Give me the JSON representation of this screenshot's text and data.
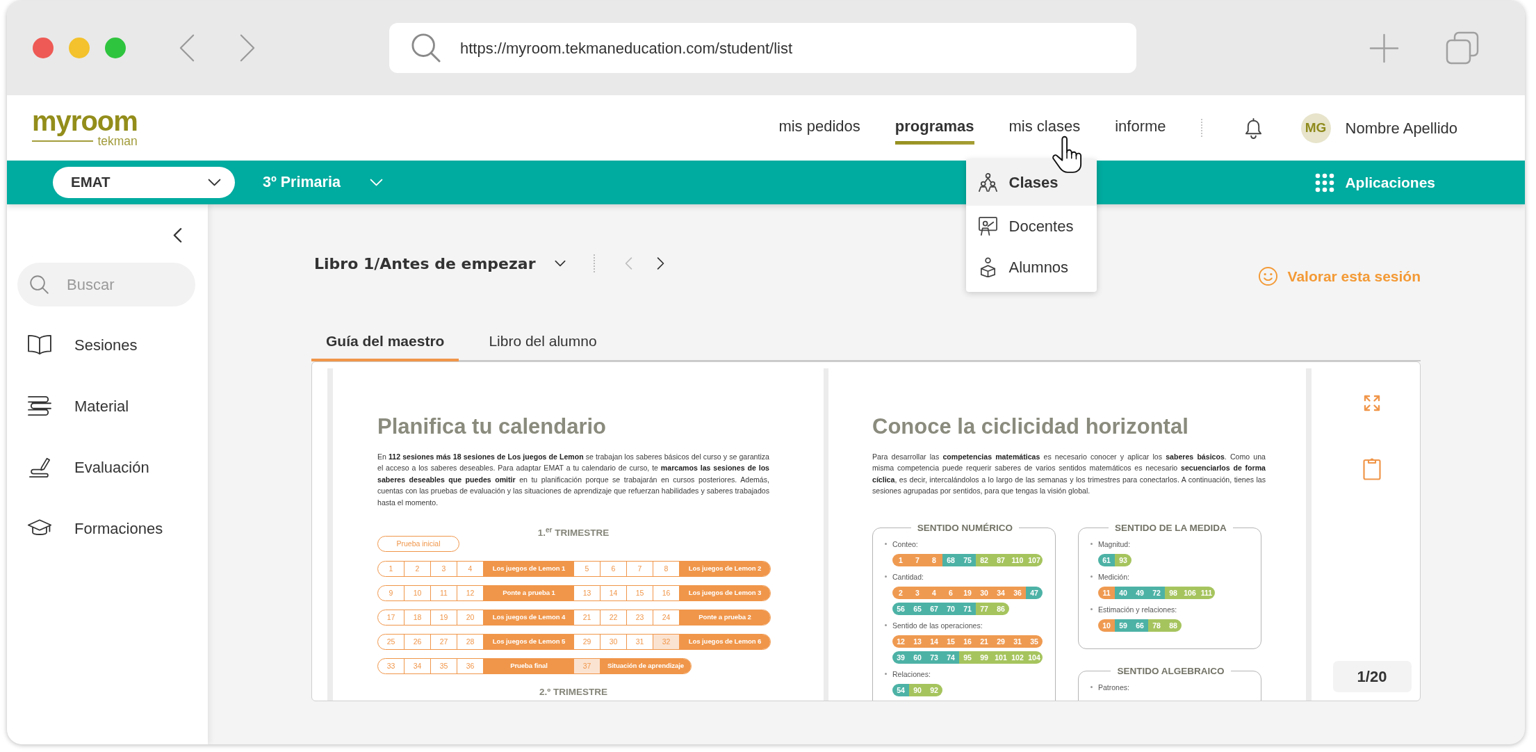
{
  "browser": {
    "url": "https://myroom.tekmaneducation.com/student/list"
  },
  "header": {
    "logo": {
      "name": "myroom",
      "tagline": "tekman"
    },
    "nav": [
      {
        "label": "mis pedidos",
        "selected": false
      },
      {
        "label": "programas",
        "selected": true
      },
      {
        "label": "mis clases",
        "selected": false,
        "menu": [
          {
            "label": "Clases",
            "selected": true
          },
          {
            "label": "Docentes",
            "selected": false
          },
          {
            "label": "Alumnos",
            "selected": false
          }
        ]
      },
      {
        "label": "informe",
        "selected": false
      }
    ],
    "user": {
      "initials": "MG",
      "name": "Nombre Apellido"
    }
  },
  "subheader": {
    "program": "EMAT",
    "grade": "3º Primaria",
    "apps": "Aplicaciones"
  },
  "sidebar": {
    "search": {
      "placeholder": "Buscar"
    },
    "items": [
      {
        "label": "Sesiones"
      },
      {
        "label": "Material"
      },
      {
        "label": "Evaluación"
      },
      {
        "label": "Formaciones"
      }
    ]
  },
  "toolbar": {
    "title": "Libro 1/Antes de empezar",
    "previous": {
      "disabled": true
    },
    "next": {
      "disabled": false
    },
    "rate": "Valorar esta sesión"
  },
  "tabs": [
    {
      "label": "Guía del maestro",
      "selected": true
    },
    {
      "label": "Libro del alumno",
      "selected": false
    }
  ],
  "viewer": {
    "pages": [
      {
        "kind": "calendar",
        "title": "Planifica tu calendario",
        "intro": "En **112 sesiones más 18 sesiones de Los juegos de Lemon** se trabajan los saberes básicos del curso y se garantiza el acceso a los saberes deseables. Para adaptar EMAT a tu calendario de curso, te **marcamos las sesiones de los saberes deseables que puedes omitir** en tu planificación porque se trabajarán en cursos posteriores. Además, cuentas con las pruebas de evaluación y las situaciones de aprendizaje que refuerzan habilidades y saberes trabajados hasta el momento.",
        "terms": [
          {
            "heading": "1.$^{er}$ TRIMESTRE",
            "badge": "Prueba inicial",
            "rows": [
              {
                "cells": [
                  {
                    "kind": "session",
                    "text": "1",
                    "highlighted": false
                  },
                  {
                    "kind": "session",
                    "text": "2",
                    "highlighted": false
                  },
                  {
                    "kind": "session",
                    "text": "3",
                    "highlighted": false
                  },
                  {
                    "kind": "session",
                    "text": "4",
                    "highlighted": false
                  },
                  {
                    "kind": "activity",
                    "text": "Los juegos de Lemon 1"
                  },
                  {
                    "kind": "session",
                    "text": "5",
                    "highlighted": false
                  },
                  {
                    "kind": "session",
                    "text": "6",
                    "highlighted": false
                  },
                  {
                    "kind": "session",
                    "text": "7",
                    "highlighted": false
                  },
                  {
                    "kind": "session",
                    "text": "8",
                    "highlighted": false
                  },
                  {
                    "kind": "activity",
                    "text": "Los juegos de Lemon 2"
                  }
                ]
              },
              {
                "cells": [
                  {
                    "kind": "session",
                    "text": "9",
                    "highlighted": false
                  },
                  {
                    "kind": "session",
                    "text": "10",
                    "highlighted": false
                  },
                  {
                    "kind": "session",
                    "text": "11",
                    "highlighted": false
                  },
                  {
                    "kind": "session",
                    "text": "12",
                    "highlighted": false
                  },
                  {
                    "kind": "activity",
                    "text": "Ponte a prueba 1"
                  },
                  {
                    "kind": "session",
                    "text": "13",
                    "highlighted": false
                  },
                  {
                    "kind": "session",
                    "text": "14",
                    "highlighted": false
                  },
                  {
                    "kind": "session",
                    "text": "15",
                    "highlighted": false
                  },
                  {
                    "kind": "session",
                    "text": "16",
                    "highlighted": false
                  },
                  {
                    "kind": "activity",
                    "text": "Los juegos de Lemon 3"
                  }
                ]
              },
              {
                "cells": [
                  {
                    "kind": "session",
                    "text": "17",
                    "highlighted": false
                  },
                  {
                    "kind": "session",
                    "text": "18",
                    "highlighted": false
                  },
                  {
                    "kind": "session",
                    "text": "19",
                    "highlighted": false
                  },
                  {
                    "kind": "session",
                    "text": "20",
                    "highlighted": false
                  },
                  {
                    "kind": "activity",
                    "text": "Los juegos de Lemon 4"
                  },
                  {
                    "kind": "session",
                    "text": "21",
                    "highlighted": false
                  },
                  {
                    "kind": "session",
                    "text": "22",
                    "highlighted": false
                  },
                  {
                    "kind": "session",
                    "text": "23",
                    "highlighted": false
                  },
                  {
                    "kind": "session",
                    "text": "24",
                    "highlighted": false
                  },
                  {
                    "kind": "activity",
                    "text": "Ponte a prueba 2"
                  }
                ]
              },
              {
                "cells": [
                  {
                    "kind": "session",
                    "text": "25",
                    "highlighted": false
                  },
                  {
                    "kind": "session",
                    "text": "26",
                    "highlighted": false
                  },
                  {
                    "kind": "session",
                    "text": "27",
                    "highlighted": false
                  },
                  {
                    "kind": "session",
                    "text": "28",
                    "highlighted": false
                  },
                  {
                    "kind": "activity",
                    "text": "Los juegos de Lemon 5"
                  },
                  {
                    "kind": "session",
                    "text": "29",
                    "highlighted": false
                  },
                  {
                    "kind": "session",
                    "text": "30",
                    "highlighted": false
                  },
                  {
                    "kind": "session",
                    "text": "31",
                    "highlighted": false
                  },
                  {
                    "kind": "session",
                    "text": "32",
                    "highlighted": true
                  },
                  {
                    "kind": "activity",
                    "text": "Los juegos de Lemon 6"
                  }
                ]
              },
              {
                "cells": [
                  {
                    "kind": "session",
                    "text": "33",
                    "highlighted": false
                  },
                  {
                    "kind": "session",
                    "text": "34",
                    "highlighted": false
                  },
                  {
                    "kind": "session",
                    "text": "35",
                    "highlighted": false
                  },
                  {
                    "kind": "session",
                    "text": "36",
                    "highlighted": false
                  },
                  {
                    "kind": "activity",
                    "text": "Prueba final"
                  },
                  {
                    "kind": "session",
                    "text": "37",
                    "highlighted": true
                  },
                  {
                    "kind": "activity",
                    "text": "Situación de aprendizaje"
                  }
                ]
              }
            ]
          },
          {
            "heading": "2.º TRIMESTRE"
          }
        ]
      },
      {
        "kind": "cycles",
        "title": "Conoce la ciclicidad horizontal",
        "intro": "Para desarrollar las **competencias matemáticas** es necesario conocer y aplicar los **saberes básicos**. Como una misma competencia puede requerir saberes de varios sentidos matemáticos es necesario **secuenciarlos de forma cíclica**, es decir, intercalándolos a lo largo de las semanas y los trimestres para conectarlos. A continuación, tienes las sesiones agrupadas por sentidos, para que tengas la visión global.",
        "columns": [
          {
            "panels": [
              {
                "heading": "SENTIDO NUMÉRICO",
                "topics": [
                  {
                    "label": "Conteo:",
                    "strips": [
                      [
                        {
                          "color": "#ef9a51",
                          "numbers": [
                            "1",
                            "7",
                            "8"
                          ]
                        },
                        {
                          "color": "#4db2a6",
                          "numbers": [
                            "68",
                            "75"
                          ]
                        },
                        {
                          "color": "#a6c45e",
                          "numbers": [
                            "82",
                            "87",
                            "110",
                            "107"
                          ]
                        }
                      ]
                    ]
                  },
                  {
                    "label": "Cantidad:",
                    "strips": [
                      [
                        {
                          "color": "#ef9a51",
                          "numbers": [
                            "2",
                            "3",
                            "4",
                            "6",
                            "19",
                            "30",
                            "34",
                            "36"
                          ]
                        },
                        {
                          "color": "#4db2a6",
                          "numbers": [
                            "47"
                          ]
                        }
                      ],
                      [
                        {
                          "color": "#4db2a6",
                          "numbers": [
                            "56",
                            "65",
                            "67",
                            "70",
                            "71"
                          ]
                        },
                        {
                          "color": "#a6c45e",
                          "numbers": [
                            "77",
                            "86"
                          ]
                        }
                      ]
                    ]
                  },
                  {
                    "label": "Sentido de las operaciones:",
                    "strips": [
                      [
                        {
                          "color": "#ef9a51",
                          "numbers": [
                            "12",
                            "13",
                            "14",
                            "15",
                            "16",
                            "21",
                            "29",
                            "31",
                            "35"
                          ]
                        }
                      ],
                      [
                        {
                          "color": "#4db2a6",
                          "numbers": [
                            "39",
                            "60",
                            "73",
                            "74"
                          ]
                        },
                        {
                          "color": "#a6c45e",
                          "numbers": [
                            "95",
                            "99",
                            "101",
                            "102",
                            "104"
                          ]
                        }
                      ]
                    ]
                  },
                  {
                    "label": "Relaciones:",
                    "strips": [
                      [
                        {
                          "color": "#4db2a6",
                          "numbers": [
                            "54"
                          ]
                        },
                        {
                          "color": "#a6c45e",
                          "numbers": [
                            "90",
                            "92"
                          ]
                        }
                      ]
                    ]
                  }
                ]
              }
            ]
          },
          {
            "panels": [
              {
                "heading": "SENTIDO DE LA MEDIDA",
                "topics": [
                  {
                    "label": "Magnitud:",
                    "strips": [
                      [
                        {
                          "color": "#4db2a6",
                          "numbers": [
                            "61"
                          ]
                        },
                        {
                          "color": "#a6c45e",
                          "numbers": [
                            "93"
                          ]
                        }
                      ]
                    ]
                  },
                  {
                    "label": "Medición:",
                    "strips": [
                      [
                        {
                          "color": "#ef9a51",
                          "numbers": [
                            "11"
                          ]
                        },
                        {
                          "color": "#4db2a6",
                          "numbers": [
                            "40",
                            "49",
                            "72"
                          ]
                        },
                        {
                          "color": "#a6c45e",
                          "numbers": [
                            "98",
                            "106",
                            "111"
                          ]
                        }
                      ]
                    ]
                  },
                  {
                    "label": "Estimación y relaciones:",
                    "strips": [
                      [
                        {
                          "color": "#ef9a51",
                          "numbers": [
                            "10"
                          ]
                        },
                        {
                          "color": "#4db2a6",
                          "numbers": [
                            "59",
                            "66"
                          ]
                        },
                        {
                          "color": "#a6c45e",
                          "numbers": [
                            "78",
                            "88"
                          ]
                        }
                      ]
                    ]
                  }
                ]
              },
              {
                "heading": "SENTIDO ALGEBRAICO",
                "topics": [
                  {
                    "label": "Patrones:"
                  }
                ]
              }
            ]
          }
        ]
      }
    ],
    "page_indicator": "1/20"
  }
}
